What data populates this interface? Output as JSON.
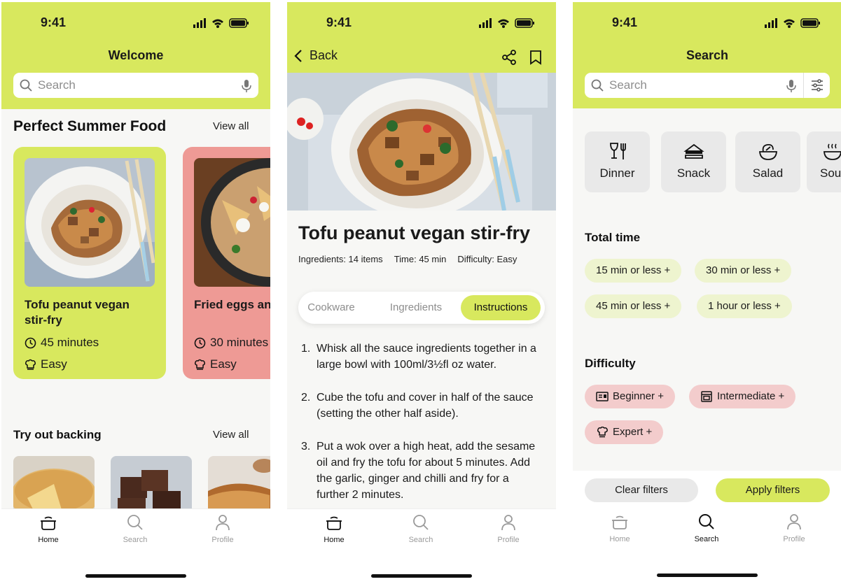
{
  "status": {
    "time": "9:41"
  },
  "home": {
    "title": "Welcome",
    "search_placeholder": "Search",
    "featured": {
      "title": "Perfect Summer Food",
      "view_all": "View all",
      "cards": [
        {
          "title": "Tofu peanut vegan stir-fry",
          "time": "45 minutes",
          "difficulty": "Easy",
          "color": "#d8e85e"
        },
        {
          "title": "Fried eggs and salsa on tortillas",
          "time": "30 minutes",
          "difficulty": "Easy",
          "color": "#ee9a95"
        }
      ]
    },
    "baking": {
      "title": "Try out backing",
      "view_all": "View all"
    }
  },
  "tabbar": {
    "home": "Home",
    "search": "Search",
    "profile": "Profile"
  },
  "recipe": {
    "back": "Back",
    "title": "Tofu peanut vegan stir-fry",
    "ingredients": "Ingredients: 14 items",
    "time": "Time: 45 min",
    "difficulty": "Difficulty: Easy",
    "tabs": [
      "Cookware",
      "Ingredients",
      "Instructions"
    ],
    "active_tab": "Instructions",
    "steps": [
      {
        "num": "1.",
        "text": "Whisk all the sauce ingredients together in a large bowl with 100ml/3½fl oz water."
      },
      {
        "num": "2.",
        "text": "Cube the tofu and cover in half of the sauce (setting the other half aside)."
      },
      {
        "num": "3.",
        "text": "Put a wok over a high heat, add the sesame oil and fry the tofu for about 5 minutes. Add the garlic, ginger and chilli and fry for a further 2 minutes."
      }
    ]
  },
  "search": {
    "title": "Search",
    "search_placeholder": "Search",
    "categories": [
      "Dinner",
      "Snack",
      "Salad",
      "Soup"
    ],
    "total_time": {
      "title": "Total time",
      "chips": [
        "15 min or less +",
        "30 min or less +",
        "45 min or less +",
        "1 hour or less +"
      ]
    },
    "difficulty": {
      "title": "Difficulty",
      "chips": [
        "Beginner +",
        "Intermediate +",
        "Expert +"
      ]
    },
    "clear": "Clear filters",
    "apply": "Apply filters"
  },
  "colors": {
    "accent": "#d8e85e",
    "accent_light": "#eef4cf",
    "coral": "#ee9a95",
    "pink_light": "#f3cccc"
  }
}
